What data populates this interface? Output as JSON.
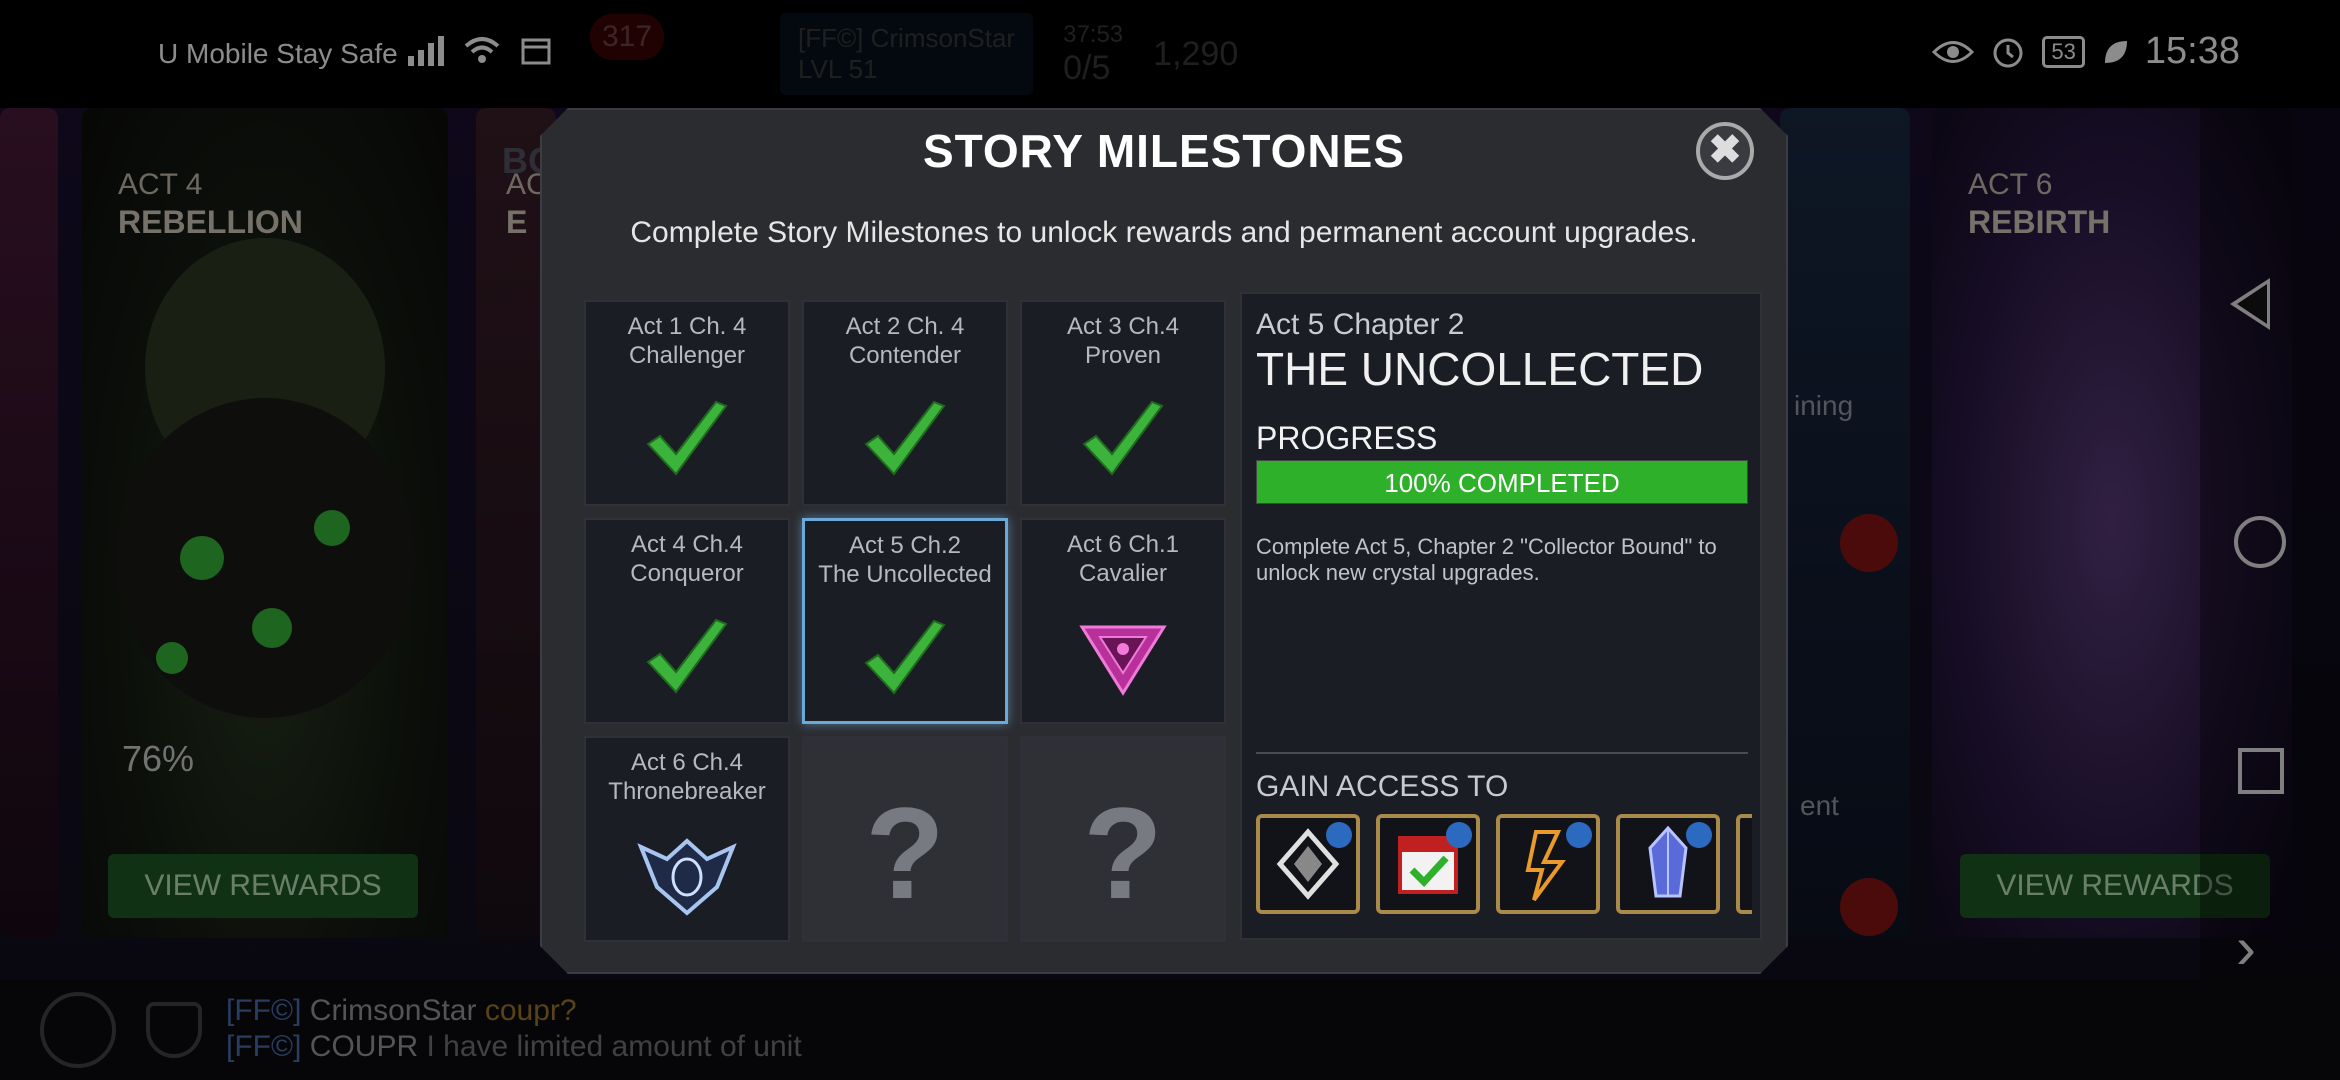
{
  "status_bar": {
    "carrier": "U Mobile Stay Safe",
    "battery": "53",
    "time": "15:38",
    "icons": [
      "signal-icon",
      "wifi-icon",
      "calendar-icon",
      "eye-icon",
      "alarm-icon",
      "leaf-icon"
    ]
  },
  "hud": {
    "badge_count": "317",
    "alliance_tag": "[FF©]",
    "player_name": "CrimsonStar",
    "level": "LVL 51",
    "timer": "37:53",
    "energy": "0/5",
    "currency": "1,290"
  },
  "background": {
    "act4": {
      "label": "ACT 4",
      "name": "REBELLION",
      "progress": "76%",
      "button": "VIEW REWARDS"
    },
    "act5_partial": {
      "label": "AC",
      "name": "E"
    },
    "act6": {
      "label": "ACT 6",
      "name": "REBIRTH",
      "button": "VIEW REWARDS"
    },
    "hidden_title": "BO",
    "partial_right_1": "ining",
    "partial_right_2": "ent"
  },
  "chat": {
    "line1": {
      "tag": "[FF©]",
      "name": "CrimsonStar",
      "message": "coupr?"
    },
    "line2": {
      "tag": "[FF©]",
      "name": "COUPR",
      "message": "I have limited amount of unit"
    }
  },
  "modal": {
    "title": "STORY MILESTONES",
    "close": "✖",
    "subtitle": "Complete Story Milestones to unlock rewards and permanent account upgrades.",
    "milestones": [
      {
        "line1": "Act 1 Ch. 4",
        "line2": "Challenger",
        "status": "completed",
        "icon": "check-icon"
      },
      {
        "line1": "Act 2 Ch. 4",
        "line2": "Contender",
        "status": "completed",
        "icon": "check-icon"
      },
      {
        "line1": "Act 3 Ch.4",
        "line2": "Proven",
        "status": "completed",
        "icon": "check-icon"
      },
      {
        "line1": "Act 4 Ch.4",
        "line2": "Conqueror",
        "status": "completed",
        "icon": "check-icon"
      },
      {
        "line1": "Act 5 Ch.2",
        "line2": "The Uncollected",
        "status": "completed",
        "icon": "check-icon",
        "selected": true
      },
      {
        "line1": "Act 6 Ch.1",
        "line2": "Cavalier",
        "status": "in-progress",
        "icon": "cavalier-emblem-icon"
      },
      {
        "line1": "Act 6 Ch.4",
        "line2": "Thronebreaker",
        "status": "in-progress",
        "icon": "thronebreaker-emblem-icon"
      },
      {
        "line1": "",
        "line2": "",
        "status": "locked",
        "icon": "question-mark-icon",
        "text": "?"
      },
      {
        "line1": "",
        "line2": "",
        "status": "locked",
        "icon": "question-mark-icon",
        "text": "?"
      }
    ],
    "detail": {
      "subtitle": "Act 5 Chapter 2",
      "title": "THE UNCOLLECTED",
      "progress_label": "PROGRESS",
      "progress_value": 1.0,
      "progress_text": "100% COMPLETED",
      "description": "Complete Act 5, Chapter 2 \"Collector Bound\" to unlock new crystal upgrades.",
      "gain_label": "GAIN ACCESS TO",
      "rewards": [
        "uncollected-emblem-icon",
        "daily-quest-calendar-icon",
        "lightning-crest-icon",
        "crystal-icon",
        "partial-reward-icon"
      ]
    }
  },
  "colors": {
    "accent_green": "#2fb02a",
    "selected_border": "#6aa9d8",
    "reward_frame": "#a98a4a",
    "lock_red": "#8a1414"
  }
}
